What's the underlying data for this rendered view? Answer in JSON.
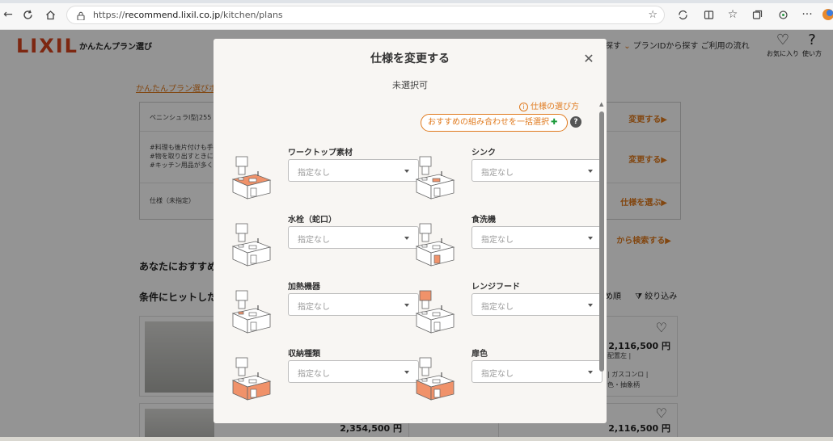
{
  "browser": {
    "url_prefix": "https://",
    "url_domain": "recommend.lixil.co.jp",
    "url_path": "/kitchen/plans"
  },
  "site": {
    "logo": "LIXIL",
    "logo_sub": "かんたんプラン選び",
    "nav_text": "探す",
    "nav_plan_id": "プランIDから探す",
    "nav_guide": "ご利用の流れ",
    "fav_label": "お気に入り",
    "howto_label": "使い方"
  },
  "page": {
    "breadcrumb": "かんたんプラン選びホ",
    "spec_rows": [
      {
        "text": "ペニンシュラⅠ型|255",
        "action": "変更する▶"
      },
      {
        "text": "#料理も後片付けも手早\n#物を取り出すときに\n#キッチン用品が多く",
        "action": "変更する▶"
      },
      {
        "text": "仕様（未指定）",
        "action": "仕様を選ぶ▶"
      }
    ],
    "search_link": "から検索する▶",
    "rec_title": "あなたにおすすめ",
    "hit_title": "条件にヒットした",
    "sort_label": "め順",
    "filter_label": "絞り込み",
    "results": [
      {
        "price": "2,116,500 円",
        "l1": "配置左 |",
        "l2": "| ガスコンロ |",
        "l3": "色・抽象柄"
      },
      {
        "price": "2,354,500 円"
      },
      {
        "price": "2,116,500 円"
      }
    ]
  },
  "modal": {
    "title": "仕様を変更する",
    "subtitle": "未選択可",
    "howto": "仕様の選び方",
    "recommend_button": "おすすめの組み合わせを一括選択",
    "items": [
      {
        "label": "ワークトップ素材",
        "value": "指定なし",
        "hl": "worktop"
      },
      {
        "label": "シンク",
        "value": "指定なし",
        "hl": "sink"
      },
      {
        "label": "水栓（蛇口）",
        "value": "指定なし",
        "hl": "faucet"
      },
      {
        "label": "食洗機",
        "value": "指定なし",
        "hl": "dishwasher"
      },
      {
        "label": "加熱機器",
        "value": "指定なし",
        "hl": "stove"
      },
      {
        "label": "レンジフード",
        "value": "指定なし",
        "hl": "hood"
      },
      {
        "label": "収納種類",
        "value": "指定なし",
        "hl": "storage"
      },
      {
        "label": "扉色",
        "value": "指定なし",
        "hl": "door"
      }
    ]
  },
  "colors": {
    "accent": "#e07a1e",
    "brand": "#d7441e",
    "highlight": "#f0926a"
  }
}
